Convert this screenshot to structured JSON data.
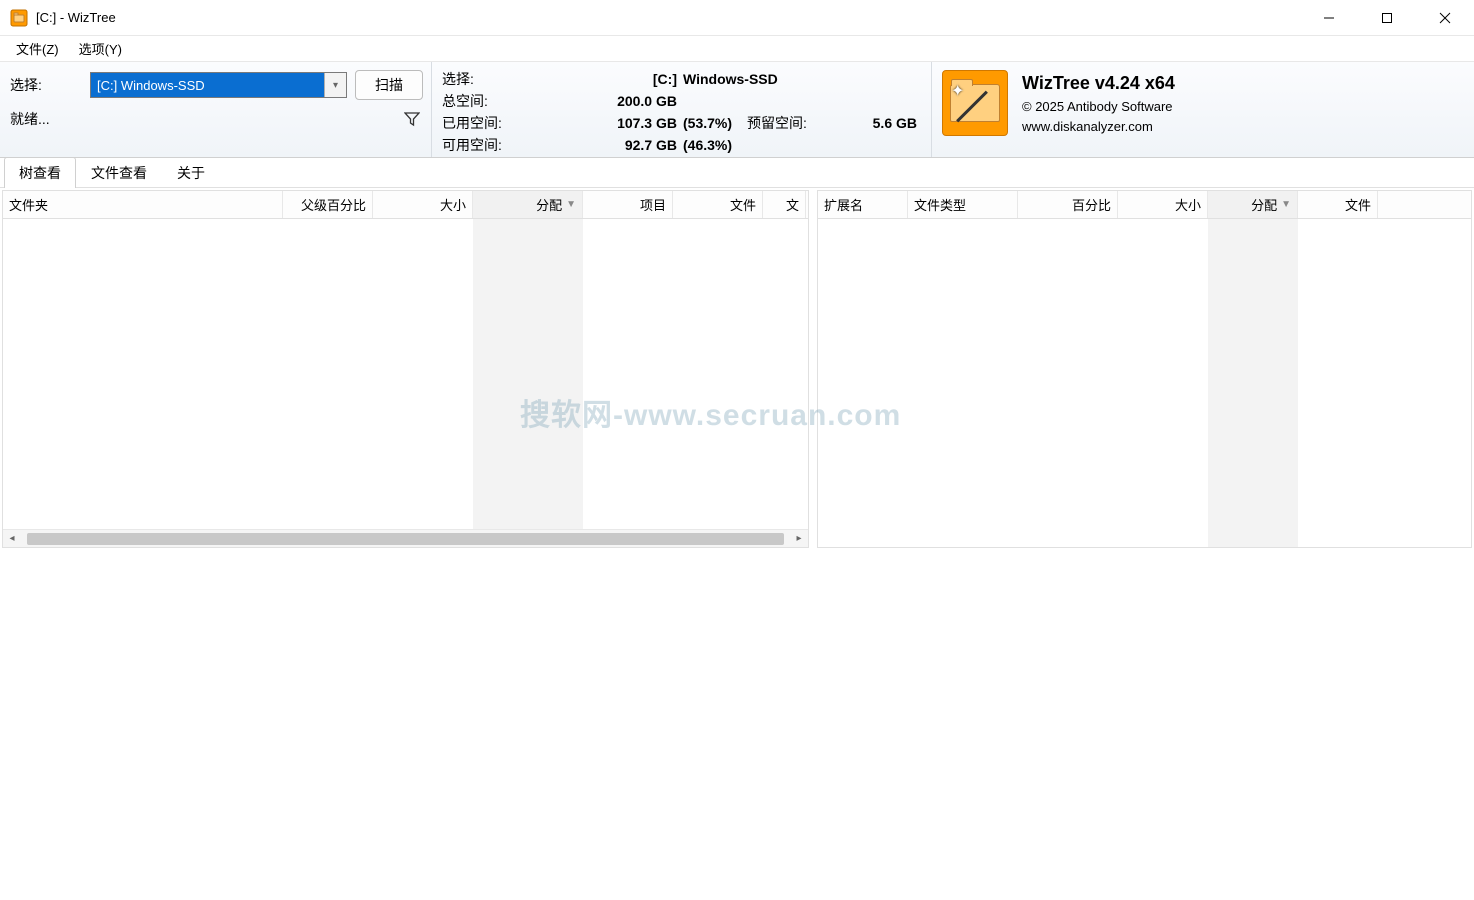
{
  "title_bar": {
    "title": "[C:]  - WizTree"
  },
  "menu": {
    "file": "文件(Z)",
    "options": "选项(Y)"
  },
  "toolbar": {
    "select_label": "选择:",
    "drive_value": "[C:] Windows-SSD",
    "scan_label": "扫描",
    "status_label": "就绪..."
  },
  "disk_info": {
    "select_label": "选择:",
    "select_value_prefix": "[C:]",
    "select_value": "Windows-SSD",
    "total_label": "总空间:",
    "total_value": "200.0 GB",
    "used_label": "已用空间:",
    "used_value": "107.3 GB",
    "used_pct": "(53.7%)",
    "reserved_label": "预留空间:",
    "reserved_value": "5.6 GB",
    "free_label": "可用空间:",
    "free_value": "92.7 GB",
    "free_pct": "(46.3%)"
  },
  "about": {
    "title": "WizTree v4.24 x64",
    "copyright": "© 2025 Antibody Software",
    "url": "www.diskanalyzer.com"
  },
  "tabs": {
    "tree": "树查看",
    "file": "文件查看",
    "about": "关于"
  },
  "left_grid": {
    "cols": {
      "c0": "文件夹",
      "c1": "父级百分比",
      "c2": "大小",
      "c3": "分配",
      "c4": "项目",
      "c5": "文件",
      "c6": "文"
    }
  },
  "right_grid": {
    "cols": {
      "c0": "扩展名",
      "c1": "文件类型",
      "c2": "百分比",
      "c3": "大小",
      "c4": "分配",
      "c5": "文件"
    }
  },
  "watermark": "搜软网-www.secruan.com"
}
